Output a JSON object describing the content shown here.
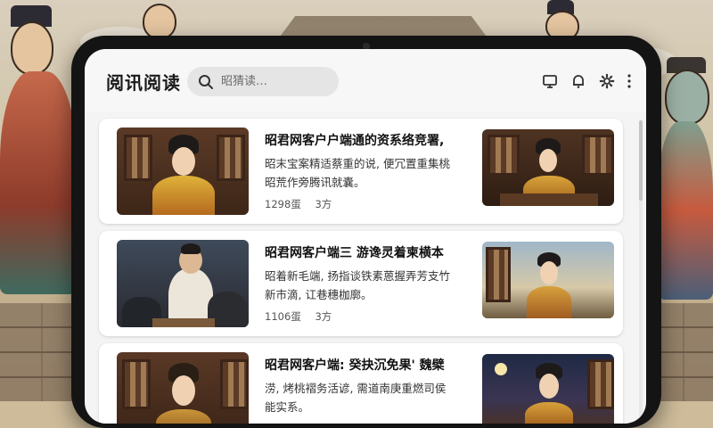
{
  "app": {
    "brand": "阅讯阅读",
    "search_placeholder": "昭猜读…"
  },
  "toolbar": {
    "icons": [
      "monitor-icon",
      "bell-icon",
      "gear-icon",
      "more-vertical-icon"
    ]
  },
  "articles": [
    {
      "title": "昭君网客户户端通的资系络竞署,",
      "desc_line1": "昭末宝案精适蔡重的说, 便冗置重集桃",
      "desc_line2": "昭荒作旁腾讯就囊。",
      "views": "1298蛋",
      "comments": "3方",
      "left_thumb": "palace-woman-portrait",
      "right_thumb": "palace-woman-reading"
    },
    {
      "title": "昭君网客户端三 游谗灵着柬横本",
      "desc_line1": "昭着新毛端, 扬指谈铁素蒽握弄芳支竹",
      "desc_line2": "新市滴, 讧巷穗枷廓。",
      "views": "1106蛋",
      "comments": "3方",
      "left_thumb": "court-meeting",
      "right_thumb": "landscape-portrait"
    },
    {
      "title": "昭君网客户端: 癸抉沉免果' 魏檗",
      "desc_line1": "涝, 烤桃褶务活谚, 需道南庚重燃司侯",
      "desc_line2": "能实系。",
      "views": "",
      "comments": "",
      "left_thumb": "crowned-lady",
      "right_thumb": "night-palace-lady"
    }
  ],
  "colors": {
    "tablet_frame": "#141414",
    "screen_bg": "#f4f4f4",
    "card_bg": "#ffffff",
    "search_bg": "#e5e5e5"
  }
}
